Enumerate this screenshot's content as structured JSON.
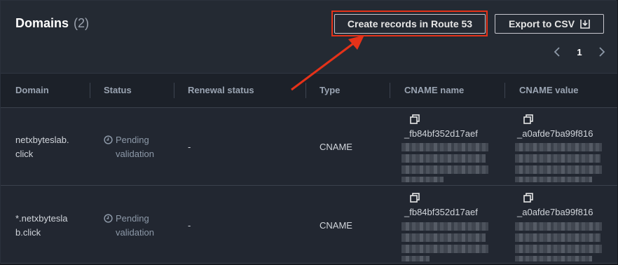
{
  "header": {
    "title": "Domains",
    "count": "(2)",
    "create_button": "Create records in Route 53",
    "export_button": "Export to CSV",
    "page_number": "1"
  },
  "table": {
    "columns": [
      "Domain",
      "Status",
      "Renewal status",
      "Type",
      "CNAME name",
      "CNAME value"
    ],
    "rows": [
      {
        "domain_line1": "netxbyteslab.",
        "domain_line2": "click",
        "status_line1": "Pending",
        "status_line2": "validation",
        "renewal": "-",
        "type": "CNAME",
        "cname_name": "_fb84bf352d17aef",
        "cname_value": "_a0afde7ba99f816"
      },
      {
        "domain_line1": "*.netxbytesla",
        "domain_line2": "b.click",
        "status_line1": "Pending",
        "status_line2": "validation",
        "renewal": "-",
        "type": "CNAME",
        "cname_name": "_fb84bf352d17aef",
        "cname_value": "_a0afde7ba99f816"
      }
    ]
  },
  "colors": {
    "highlight": "#e53219",
    "background": "#222731"
  },
  "icons": {
    "status": "clock-icon",
    "copy": "copy-icon",
    "export": "download-icon",
    "prev": "chevron-left-icon",
    "next": "chevron-right-icon"
  }
}
